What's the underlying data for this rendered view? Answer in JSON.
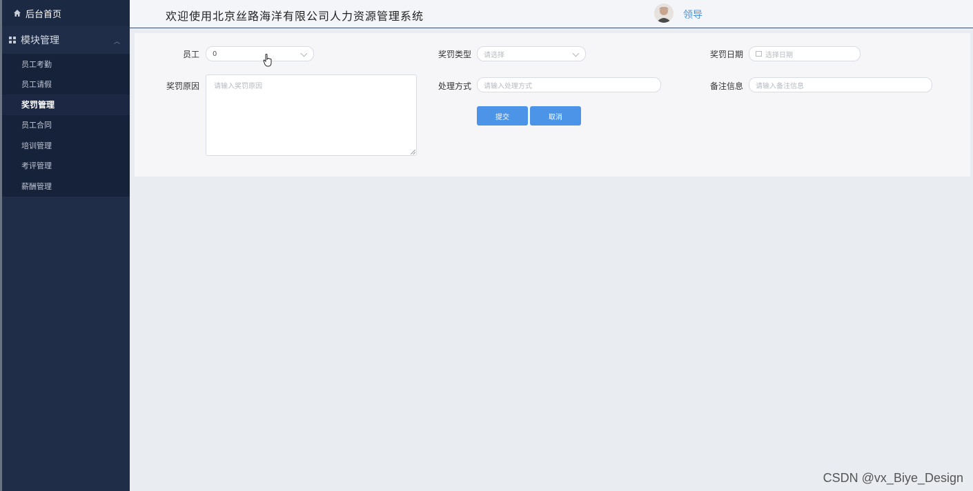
{
  "sidebar": {
    "home_label": "后台首页",
    "group_label": "模块管理",
    "items": [
      {
        "label": "员工考勤"
      },
      {
        "label": "员工请假"
      },
      {
        "label": "奖罚管理"
      },
      {
        "label": "员工合同"
      },
      {
        "label": "培训管理"
      },
      {
        "label": "考评管理"
      },
      {
        "label": "薪酬管理"
      }
    ],
    "active_item": "奖罚管理"
  },
  "header": {
    "title": "欢迎使用北京丝路海洋有限公司人力资源管理系统",
    "user_name": "领导"
  },
  "form": {
    "employee": {
      "label": "员工",
      "value": "0"
    },
    "type": {
      "label": "奖罚类型",
      "placeholder": "请选择"
    },
    "date": {
      "label": "奖罚日期",
      "placeholder": "选择日期"
    },
    "reason": {
      "label": "奖罚原因",
      "placeholder": "请输入奖罚原因"
    },
    "handling": {
      "label": "处理方式",
      "placeholder": "请输入处理方式"
    },
    "remark": {
      "label": "备注信息",
      "placeholder": "请输入备注信息"
    },
    "submit_label": "提交",
    "cancel_label": "取消"
  },
  "watermark": "CSDN @vx_Biye_Design",
  "colors": {
    "sidebar_bg": "#1f2d48",
    "accent": "#4c94e8",
    "user_link": "#4a90d9"
  }
}
